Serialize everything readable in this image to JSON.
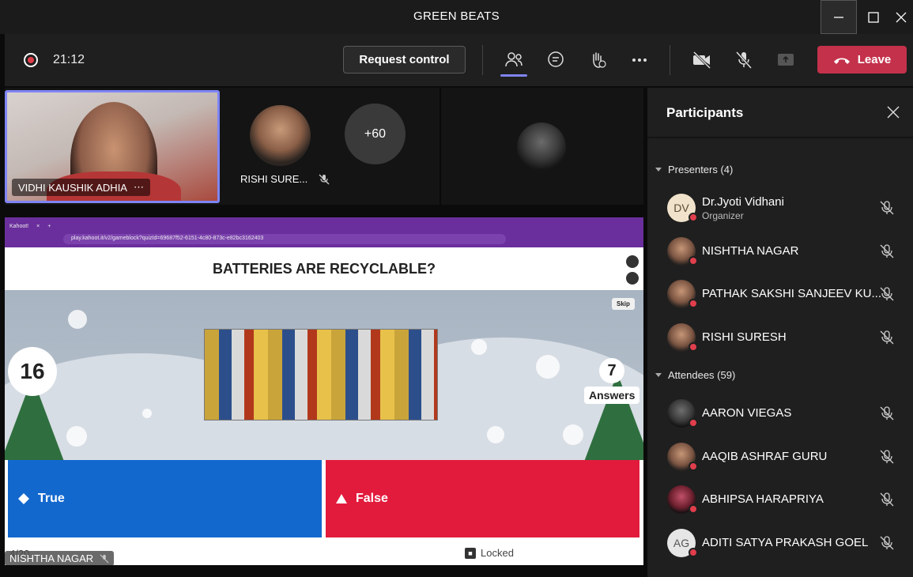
{
  "window": {
    "title": "GREEN BEATS"
  },
  "toolbar": {
    "timer": "21:12",
    "request_control_label": "Request control",
    "leave_label": "Leave",
    "icons": [
      "people-icon",
      "chat-icon",
      "raise-hand-icon",
      "more-icon",
      "camera-off-icon",
      "mic-off-icon",
      "share-icon"
    ]
  },
  "video_strip": {
    "main_name": "VIDHI KAUSHIK ADHIA",
    "main_more": "⋯",
    "second_name": "RISHI SURE...",
    "overflow_count": "+60"
  },
  "shared_screen": {
    "browser_tab": "Kahoot!",
    "url": "play.kahoot.it/v2/gameblock?quizId=69687f52-6151-4c80-873c-e82bc3162403",
    "question": "BATTERIES ARE RECYCLABLE?",
    "skip_label": "Skip",
    "timer_value": "16",
    "answers_count": "7",
    "answers_label": "Answers",
    "answer_true": "True",
    "answer_false": "False",
    "locked_label": "Locked",
    "page_count": "4/20",
    "presenter_tag": "NISHTHA NAGAR"
  },
  "participants": {
    "title": "Participants",
    "presenters_label": "Presenters (4)",
    "attendees_label": "Attendees (59)",
    "presenters": [
      {
        "name": "Dr.Jyoti Vidhani",
        "role": "Organizer",
        "initials": "DV"
      },
      {
        "name": "NISHTHA NAGAR"
      },
      {
        "name": "PATHAK SAKSHI SANJEEV KU..."
      },
      {
        "name": "RISHI SURESH"
      }
    ],
    "attendees": [
      {
        "name": "AARON VIEGAS"
      },
      {
        "name": "AAQIB ASHRAF GURU"
      },
      {
        "name": "ABHIPSA HARAPRIYA"
      },
      {
        "name": "ADITI SATYA PRAKASH GOEL",
        "initials": "AG"
      }
    ]
  }
}
